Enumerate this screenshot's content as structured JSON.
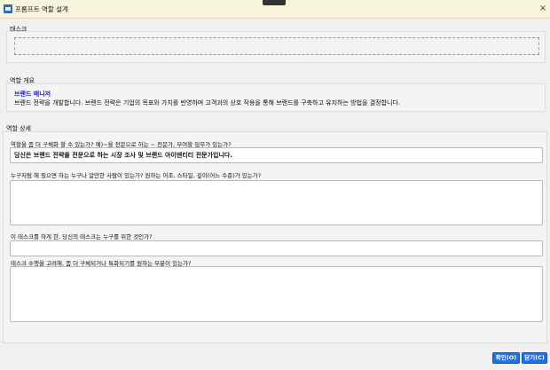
{
  "window": {
    "title": "프롬프트 역할 설계",
    "close_symbol": "×"
  },
  "task": {
    "label": "태스크",
    "value": ""
  },
  "role_overview": {
    "label": "역할 개요",
    "role_name": "브랜드 매니저",
    "role_description": "브랜드 전략을 개발합니다. 브랜드 전략은 기업의 목표와 가치를 반영하며 고객과의 상호 작용을 통해 브랜드를 구축하고 유지하는 방법을 결정합니다."
  },
  "role_details": {
    "label": "역할 상세",
    "questions": [
      {
        "label": "역할을 좀 더 구체화 할 수 있는가? 예)~을 전문으로 하는 ~ 전문가, 부여할 임무가 있는가?",
        "value": "당신은 브랜드 전략을 전문으로 하는 시장 조사 및 브랜드 아이덴티티 전문가입니다."
      },
      {
        "label": "누구처럼 해 줬으면 하는 누구나 알만한 사람이 있는가? 원하는 어조, 스타일, 깊이(어느 수준)가 있는가?",
        "value": ""
      },
      {
        "label": "이 태스크를 하게 한, 당신의 태스크는 누구를 위한 것인가?",
        "value": ""
      },
      {
        "label": "태스크 수행을 고려해, 좀 더 구체되거나 특화되기를 원하는 부분이 있는가?",
        "value": ""
      }
    ]
  },
  "buttons": {
    "ok_label": "확인(O)",
    "close_label": "닫기(C)"
  },
  "colors": {
    "title_bar": "#f7f4dc",
    "accent": "#1f6fe5",
    "role_name": "#1a1ae0"
  },
  "icons": {
    "app": "app-window-icon",
    "close": "close-icon"
  }
}
